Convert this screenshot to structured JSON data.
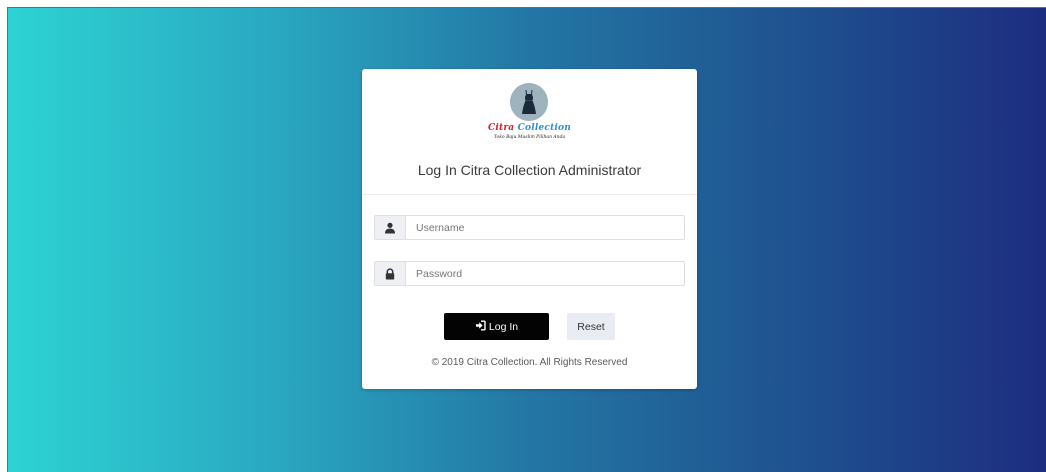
{
  "logo": {
    "name_part1": "Citra",
    "name_part2": "Collection",
    "tagline": "Toko Baju Muslim Pilihan Anda"
  },
  "login": {
    "title": "Log In Citra Collection Administrator",
    "username_placeholder": "Username",
    "password_placeholder": "Password",
    "login_label": "Log In",
    "reset_label": "Reset",
    "footer": "© 2019 Citra Collection. All Rights Reserved"
  },
  "icons": {
    "logo": "dress-icon",
    "username": "user-icon",
    "password": "lock-icon",
    "login": "sign-in-icon"
  },
  "colors": {
    "gradient_start": "#2dd3d3",
    "gradient_end": "#1d2d80",
    "login_button": "#030303",
    "reset_button": "#e9ecf2",
    "brand_red": "#d3202b",
    "brand_blue": "#2f8fd9"
  }
}
